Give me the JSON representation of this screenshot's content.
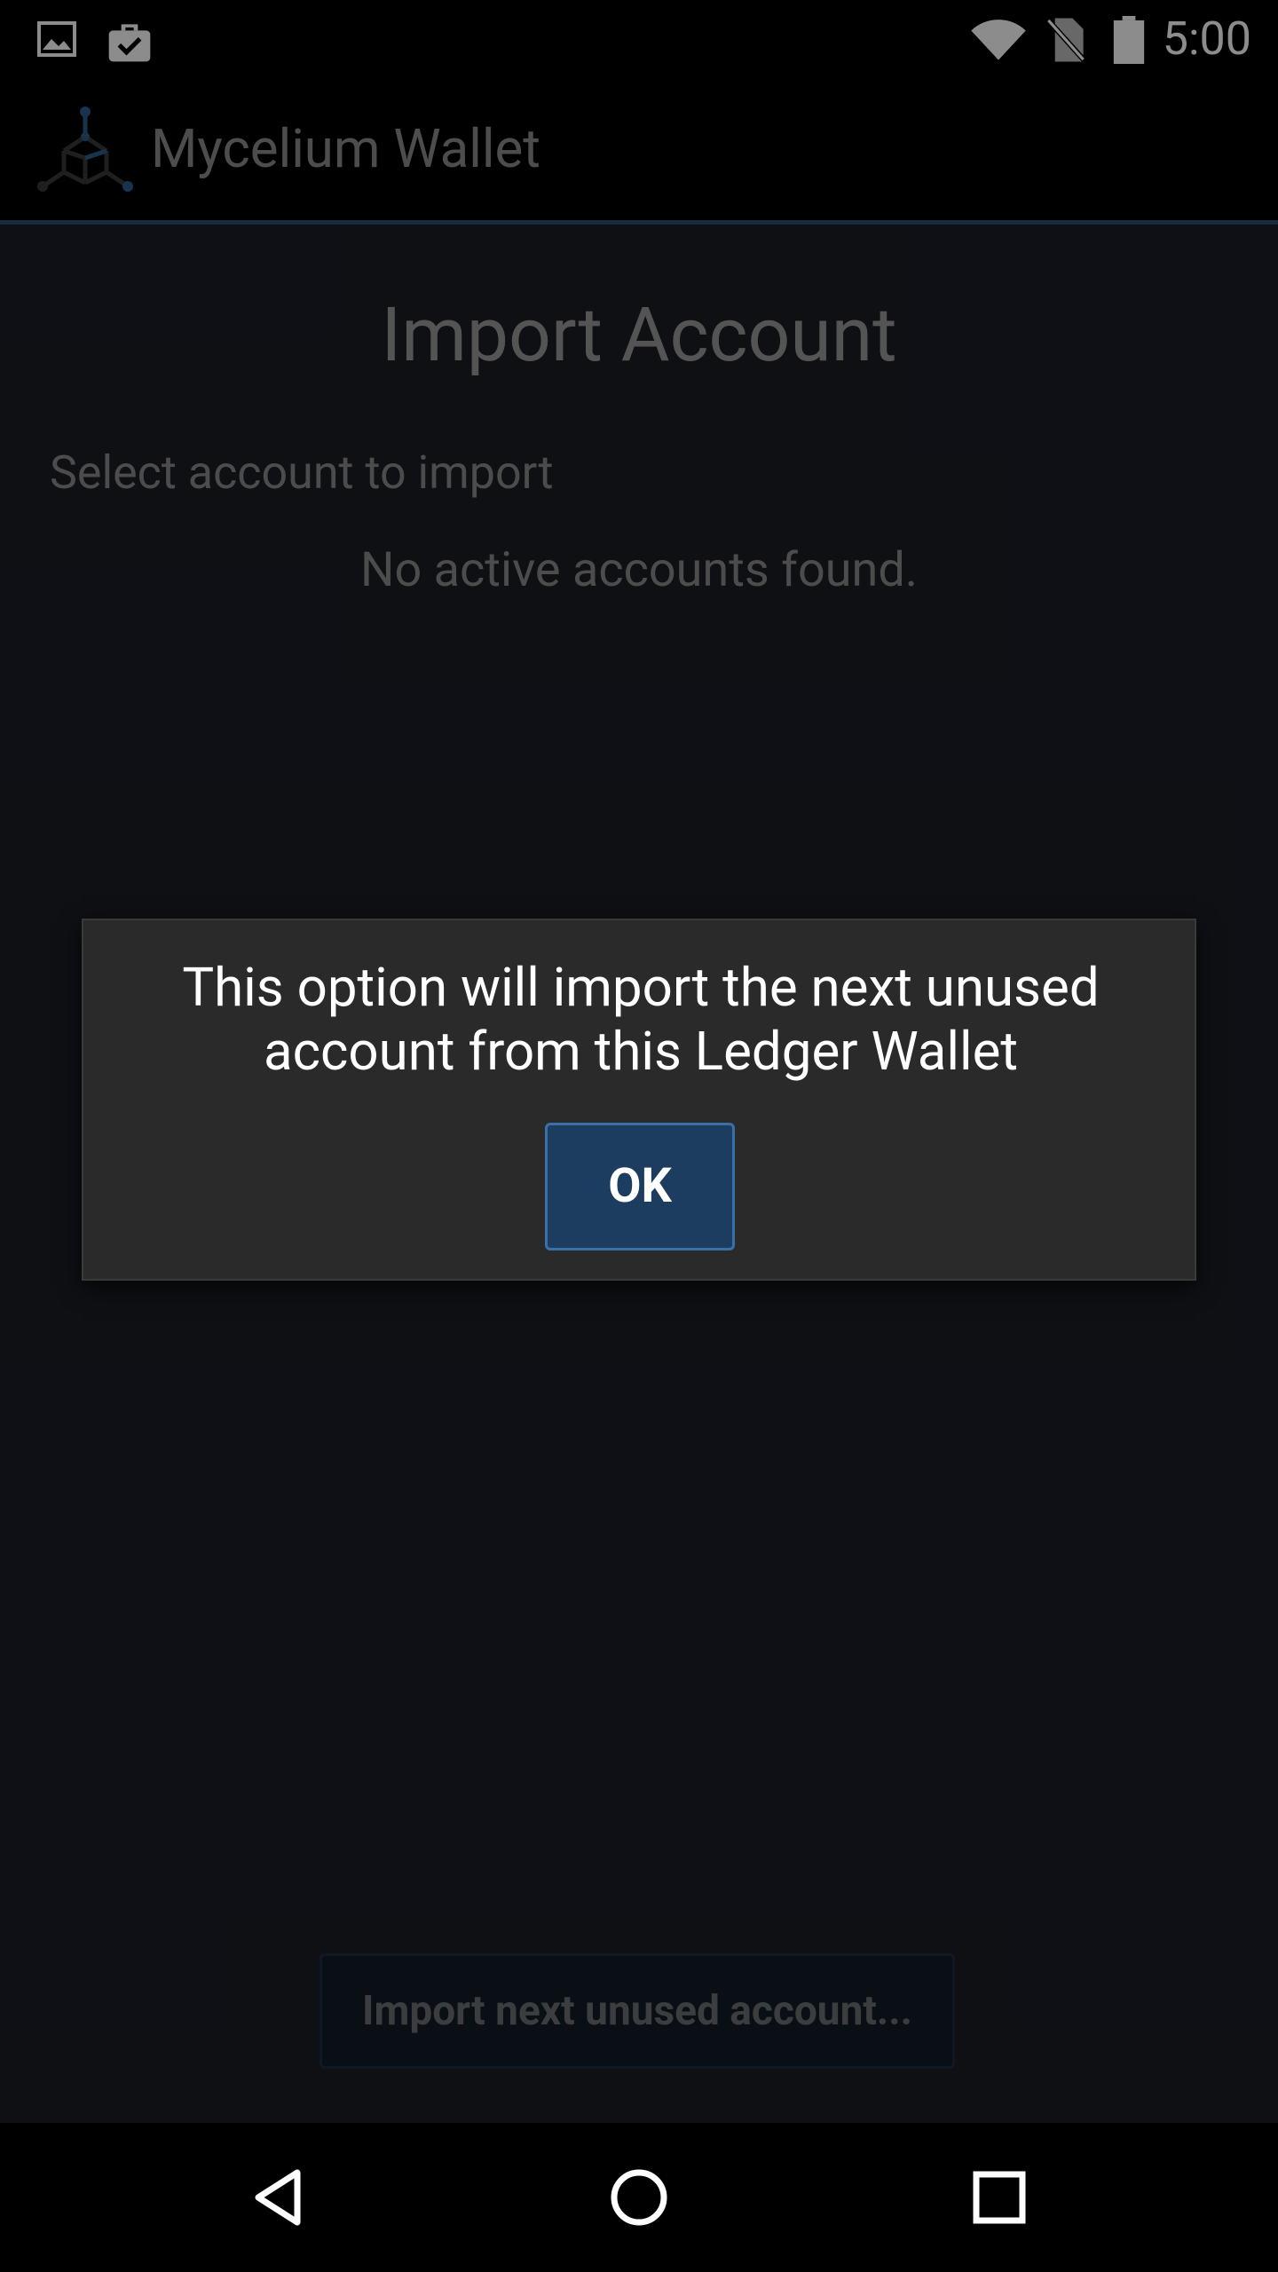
{
  "status_bar": {
    "time": "5:00",
    "icons": [
      "image-icon",
      "briefcase-check-icon",
      "wifi-icon",
      "no-sim-icon",
      "battery-icon"
    ]
  },
  "app_bar": {
    "title": "Mycelium Wallet",
    "logo_icon": "mycelium-logo-icon"
  },
  "page": {
    "title": "Import Account",
    "section_label": "Select account to import",
    "empty_message": "No active accounts found.",
    "import_next_label": "Import next unused account..."
  },
  "dialog": {
    "message": "This option will import the next unused account from this Ledger Wallet",
    "ok_label": "OK"
  },
  "nav_bar": {
    "icons": [
      "back-icon",
      "home-icon",
      "recents-icon"
    ]
  },
  "colors": {
    "accent": "#2d5177",
    "background": "#1a1e26",
    "dialog_bg": "#2a2a2b",
    "button_bg": "#1c3d5f"
  }
}
